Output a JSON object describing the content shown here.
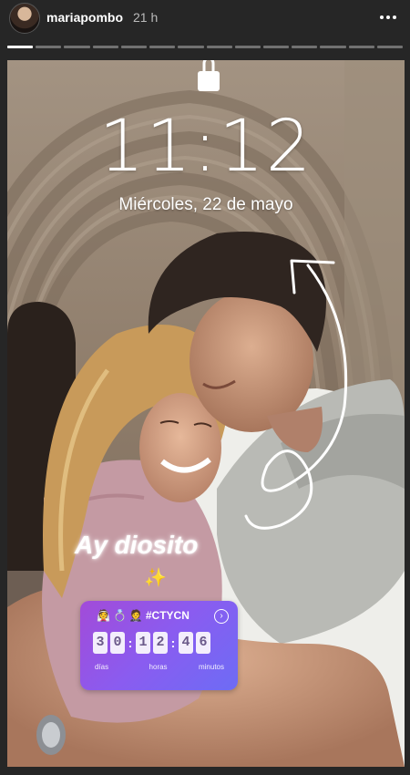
{
  "header": {
    "username": "mariapombo",
    "time_ago": "21 h"
  },
  "progress": {
    "total_segments": 14,
    "completed_segments": 1
  },
  "story": {
    "clock": "11:12",
    "date": "Miércoles, 22 de mayo",
    "caption": "Ay diosito",
    "countdown": {
      "title": "#CTYCN",
      "emojis": [
        "👰",
        "💍",
        "🤵"
      ],
      "digits": {
        "days": [
          "3",
          "0"
        ],
        "hours": [
          "1",
          "2"
        ],
        "minutes": [
          "4",
          "6"
        ]
      },
      "labels": {
        "days": "días",
        "hours": "horas",
        "minutes": "minutos"
      }
    }
  },
  "icons": {
    "more": "more-horizontal-icon",
    "avatar": "profile-avatar",
    "lock": "lock-icon",
    "chevron": "chevron-right-icon",
    "sparkle": "sparkle-icon"
  }
}
